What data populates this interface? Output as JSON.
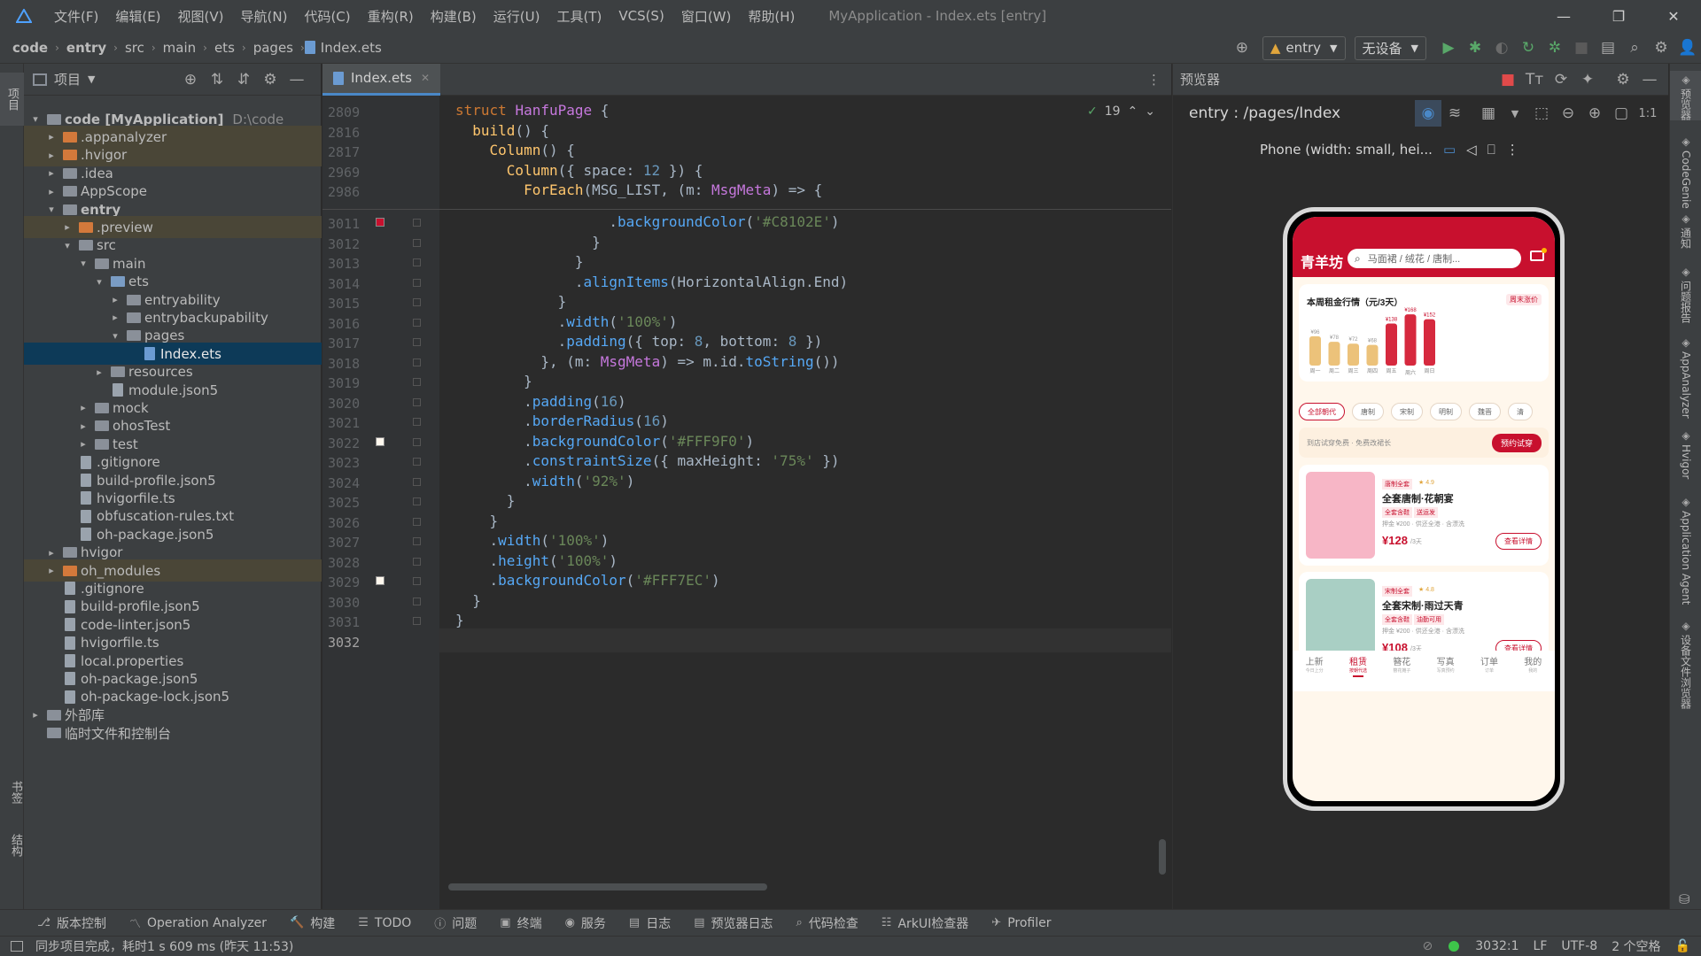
{
  "menu": {
    "items": [
      "文件(F)",
      "编辑(E)",
      "视图(V)",
      "导航(N)",
      "代码(C)",
      "重构(R)",
      "构建(B)",
      "运行(U)",
      "工具(T)",
      "VCS(S)",
      "窗口(W)",
      "帮助(H)"
    ],
    "title": "MyApplication - Index.ets [entry]"
  },
  "nav": {
    "crumbs": [
      "code",
      "entry",
      "src",
      "main",
      "ets",
      "pages",
      "Index.ets"
    ],
    "run_config": "entry",
    "device": "无设备"
  },
  "left_strip": {
    "top": "项目",
    "bookmarks": "书签",
    "structure": "结构"
  },
  "project": {
    "header": "项目",
    "tree": [
      {
        "label": "code [MyApplication]",
        "extra": "D:\\code",
        "depth": 0,
        "arrow": "▾",
        "icon": "folder",
        "bold": true
      },
      {
        "label": ".appanalyzer",
        "depth": 1,
        "arrow": "▸",
        "icon": "folder-orange",
        "hl": true
      },
      {
        "label": ".hvigor",
        "depth": 1,
        "arrow": "▸",
        "icon": "folder-orange",
        "hl": true
      },
      {
        "label": ".idea",
        "depth": 1,
        "arrow": "▸",
        "icon": "folder"
      },
      {
        "label": "AppScope",
        "depth": 1,
        "arrow": "▸",
        "icon": "folder"
      },
      {
        "label": "entry",
        "depth": 1,
        "arrow": "▾",
        "icon": "folder",
        "bold": true
      },
      {
        "label": ".preview",
        "depth": 2,
        "arrow": "▸",
        "icon": "folder-orange",
        "hl": true
      },
      {
        "label": "src",
        "depth": 2,
        "arrow": "▾",
        "icon": "folder"
      },
      {
        "label": "main",
        "depth": 3,
        "arrow": "▾",
        "icon": "folder"
      },
      {
        "label": "ets",
        "depth": 4,
        "arrow": "▾",
        "icon": "folder-blue"
      },
      {
        "label": "entryability",
        "depth": 5,
        "arrow": "▸",
        "icon": "folder"
      },
      {
        "label": "entrybackupability",
        "depth": 5,
        "arrow": "▸",
        "icon": "folder"
      },
      {
        "label": "pages",
        "depth": 5,
        "arrow": "▾",
        "icon": "folder"
      },
      {
        "label": "Index.ets",
        "depth": 6,
        "arrow": "",
        "icon": "ets",
        "sel": true
      },
      {
        "label": "resources",
        "depth": 4,
        "arrow": "▸",
        "icon": "folder"
      },
      {
        "label": "module.json5",
        "depth": 4,
        "arrow": "",
        "icon": "file"
      },
      {
        "label": "mock",
        "depth": 3,
        "arrow": "▸",
        "icon": "folder"
      },
      {
        "label": "ohosTest",
        "depth": 3,
        "arrow": "▸",
        "icon": "folder"
      },
      {
        "label": "test",
        "depth": 3,
        "arrow": "▸",
        "icon": "folder"
      },
      {
        "label": ".gitignore",
        "depth": 2,
        "arrow": "",
        "icon": "file"
      },
      {
        "label": "build-profile.json5",
        "depth": 2,
        "arrow": "",
        "icon": "file"
      },
      {
        "label": "hvigorfile.ts",
        "depth": 2,
        "arrow": "",
        "icon": "file"
      },
      {
        "label": "obfuscation-rules.txt",
        "depth": 2,
        "arrow": "",
        "icon": "file"
      },
      {
        "label": "oh-package.json5",
        "depth": 2,
        "arrow": "",
        "icon": "file"
      },
      {
        "label": "hvigor",
        "depth": 1,
        "arrow": "▸",
        "icon": "folder"
      },
      {
        "label": "oh_modules",
        "depth": 1,
        "arrow": "▸",
        "icon": "folder-orange",
        "hl": true
      },
      {
        "label": ".gitignore",
        "depth": 1,
        "arrow": "",
        "icon": "file"
      },
      {
        "label": "build-profile.json5",
        "depth": 1,
        "arrow": "",
        "icon": "file"
      },
      {
        "label": "code-linter.json5",
        "depth": 1,
        "arrow": "",
        "icon": "file"
      },
      {
        "label": "hvigorfile.ts",
        "depth": 1,
        "arrow": "",
        "icon": "file"
      },
      {
        "label": "local.properties",
        "depth": 1,
        "arrow": "",
        "icon": "file"
      },
      {
        "label": "oh-package.json5",
        "depth": 1,
        "arrow": "",
        "icon": "file"
      },
      {
        "label": "oh-package-lock.json5",
        "depth": 1,
        "arrow": "",
        "icon": "file"
      },
      {
        "label": "外部库",
        "depth": 0,
        "arrow": "▸",
        "icon": "lib"
      },
      {
        "label": "临时文件和控制台",
        "depth": 0,
        "arrow": "",
        "icon": "scratch"
      }
    ]
  },
  "editor": {
    "tab": "Index.ets",
    "inspection_count": "19",
    "sticky": [
      {
        "n": "2809",
        "code": [
          [
            "kw",
            "struct "
          ],
          [
            "ty",
            "HanfuPage"
          ],
          [
            "",
            " {"
          ]
        ]
      },
      {
        "n": "2816",
        "code": [
          [
            "",
            "  "
          ],
          [
            "fn",
            "build"
          ],
          [
            "",
            "() {"
          ]
        ]
      },
      {
        "n": "2817",
        "code": [
          [
            "",
            "    "
          ],
          [
            "fn",
            "Column"
          ],
          [
            "",
            "() {"
          ]
        ]
      },
      {
        "n": "2969",
        "code": [
          [
            "",
            "      "
          ],
          [
            "fn",
            "Column"
          ],
          [
            "",
            "({ space: "
          ],
          [
            "nu",
            "12"
          ],
          [
            "",
            " }) {"
          ]
        ]
      },
      {
        "n": "2986",
        "code": [
          [
            "",
            "        "
          ],
          [
            "fn",
            "ForEach"
          ],
          [
            "",
            "(MSG_LIST, (m: "
          ],
          [
            "ty",
            "MsgMeta"
          ],
          [
            "",
            ") => {"
          ]
        ]
      }
    ],
    "lines": [
      {
        "n": "3011",
        "code": [
          [
            "",
            "                  ."
          ],
          [
            "me",
            "backgroundColor"
          ],
          [
            "",
            "("
          ],
          [
            "st",
            "'#C8102E'"
          ],
          [
            "",
            ")"
          ]
        ],
        "marker": "red"
      },
      {
        "n": "3012",
        "code": [
          [
            "",
            "                }"
          ]
        ]
      },
      {
        "n": "3013",
        "code": [
          [
            "",
            "              }"
          ]
        ]
      },
      {
        "n": "3014",
        "code": [
          [
            "",
            "              ."
          ],
          [
            "me",
            "alignItems"
          ],
          [
            "",
            "(HorizontalAlign.End)"
          ]
        ]
      },
      {
        "n": "3015",
        "code": [
          [
            "",
            "            }"
          ]
        ]
      },
      {
        "n": "3016",
        "code": [
          [
            "",
            "            ."
          ],
          [
            "me",
            "width"
          ],
          [
            "",
            "("
          ],
          [
            "st",
            "'100%'"
          ],
          [
            "",
            ")"
          ]
        ]
      },
      {
        "n": "3017",
        "code": [
          [
            "",
            "            ."
          ],
          [
            "me",
            "padding"
          ],
          [
            "",
            "({ top: "
          ],
          [
            "nu",
            "8"
          ],
          [
            "",
            ", bottom: "
          ],
          [
            "nu",
            "8"
          ],
          [
            "",
            " })"
          ]
        ]
      },
      {
        "n": "3018",
        "code": [
          [
            "",
            "          }, (m: "
          ],
          [
            "ty",
            "MsgMeta"
          ],
          [
            "",
            ") => m.id."
          ],
          [
            "me",
            "toString"
          ],
          [
            "",
            "())"
          ]
        ]
      },
      {
        "n": "3019",
        "code": [
          [
            "",
            "        }"
          ]
        ]
      },
      {
        "n": "3020",
        "code": [
          [
            "",
            "        ."
          ],
          [
            "me",
            "padding"
          ],
          [
            "",
            "("
          ],
          [
            "nu",
            "16"
          ],
          [
            "",
            ")"
          ]
        ]
      },
      {
        "n": "3021",
        "code": [
          [
            "",
            "        ."
          ],
          [
            "me",
            "borderRadius"
          ],
          [
            "",
            "("
          ],
          [
            "nu",
            "16"
          ],
          [
            "",
            ")"
          ]
        ]
      },
      {
        "n": "3022",
        "code": [
          [
            "",
            "        ."
          ],
          [
            "me",
            "backgroundColor"
          ],
          [
            "",
            "("
          ],
          [
            "st",
            "'#FFF9F0'"
          ],
          [
            "",
            ")"
          ]
        ],
        "marker": "white"
      },
      {
        "n": "3023",
        "code": [
          [
            "",
            "        ."
          ],
          [
            "me",
            "constraintSize"
          ],
          [
            "",
            "({ maxHeight: "
          ],
          [
            "st",
            "'75%'"
          ],
          [
            "",
            " })"
          ]
        ]
      },
      {
        "n": "3024",
        "code": [
          [
            "",
            "        ."
          ],
          [
            "me",
            "width"
          ],
          [
            "",
            "("
          ],
          [
            "st",
            "'92%'"
          ],
          [
            "",
            ")"
          ]
        ]
      },
      {
        "n": "3025",
        "code": [
          [
            "",
            "      }"
          ]
        ]
      },
      {
        "n": "3026",
        "code": [
          [
            "",
            "    }"
          ]
        ]
      },
      {
        "n": "3027",
        "code": [
          [
            "",
            "    ."
          ],
          [
            "me",
            "width"
          ],
          [
            "",
            "("
          ],
          [
            "st",
            "'100%'"
          ],
          [
            "",
            ")"
          ]
        ]
      },
      {
        "n": "3028",
        "code": [
          [
            "",
            "    ."
          ],
          [
            "me",
            "height"
          ],
          [
            "",
            "("
          ],
          [
            "st",
            "'100%'"
          ],
          [
            "",
            ")"
          ]
        ]
      },
      {
        "n": "3029",
        "code": [
          [
            "",
            "    ."
          ],
          [
            "me",
            "backgroundColor"
          ],
          [
            "",
            "("
          ],
          [
            "st",
            "'#FFF7EC'"
          ],
          [
            "",
            ")"
          ]
        ],
        "marker": "white"
      },
      {
        "n": "3030",
        "code": [
          [
            "",
            "  }"
          ]
        ]
      },
      {
        "n": "3031",
        "code": [
          [
            "",
            "}"
          ]
        ]
      },
      {
        "n": "3032",
        "code": [
          [
            "",
            ""
          ]
        ],
        "current": true
      }
    ]
  },
  "previewer": {
    "title": "预览器",
    "route": "entry : /pages/Index",
    "device_label": "Phone (width: small, hei...",
    "app": {
      "brand": "青羊坊",
      "search_placeholder": "马面裙 / 绒花 / 唐制...",
      "card_title": "本周租金行情（元/3天）",
      "card_badge": "周末涨价",
      "chart_data": {
        "type": "bar",
        "categories": [
          "周一",
          "周二",
          "周三",
          "周四",
          "周五",
          "周六",
          "周日"
        ],
        "values": [
          96,
          78,
          72,
          68,
          138,
          168,
          152
        ],
        "value_labels": [
          "¥96",
          "¥78",
          "¥72",
          "¥68",
          "¥138",
          "¥168",
          "¥152"
        ]
      },
      "chips": [
        "全部朝代",
        "唐制",
        "宋制",
        "明制",
        "魏晋",
        "清"
      ],
      "promo_text": "到店试穿免费 · 免费改裙长",
      "promo_button": "预约试穿",
      "items": [
        {
          "tag": "唐制全套",
          "rating": "★ 4.9",
          "name": "全套唐制·花朝宴",
          "badges": [
            "全套含鞋",
            "送运发"
          ],
          "meta": "押金 ¥200 · 供还全港 · 含漂洗",
          "price": "¥128",
          "unit": "/3天",
          "button": "查看详情",
          "swatch": "#f7b6c6"
        },
        {
          "tag": "宋制全套",
          "rating": "★ 4.8",
          "name": "全套宋制·雨过天青",
          "badges": [
            "全套含鞋",
            "油勤可用"
          ],
          "meta": "押金 ¥200 · 供还全港 · 含漂洗",
          "price": "¥108",
          "unit": "/3天",
          "button": "查看详情",
          "swatch": "#a9cfc4"
        }
      ],
      "tabs": [
        {
          "label": "上新",
          "sub": "今日上分"
        },
        {
          "label": "租赁",
          "sub": "按朝代选",
          "active": true
        },
        {
          "label": "簪花",
          "sub": "簪花摊子"
        },
        {
          "label": "写真",
          "sub": "写真预约"
        },
        {
          "label": "订单",
          "sub": "订单"
        },
        {
          "label": "我的",
          "sub": "我的"
        }
      ]
    }
  },
  "right_strip": [
    "预览器",
    "CodeGenie",
    "通知",
    "问题报告",
    "AppAnalyzer",
    "Hvigor",
    "Application Agent",
    "设备文件浏览器"
  ],
  "bottom_tools": [
    "版本控制",
    "Operation Analyzer",
    "构建",
    "TODO",
    "问题",
    "终端",
    "服务",
    "日志",
    "预览器日志",
    "代码检查",
    "ArkUI检查器",
    "Profiler"
  ],
  "status": {
    "message": "同步项目完成，耗时1 s 609 ms (昨天 11:53)",
    "position": "3032:1",
    "line_sep": "LF",
    "encoding": "UTF-8",
    "indent": "2 个空格"
  },
  "colors": {
    "brand": "#C8102E",
    "page_bg": "#FFF7EC",
    "card_bg": "#FFF9F0"
  }
}
